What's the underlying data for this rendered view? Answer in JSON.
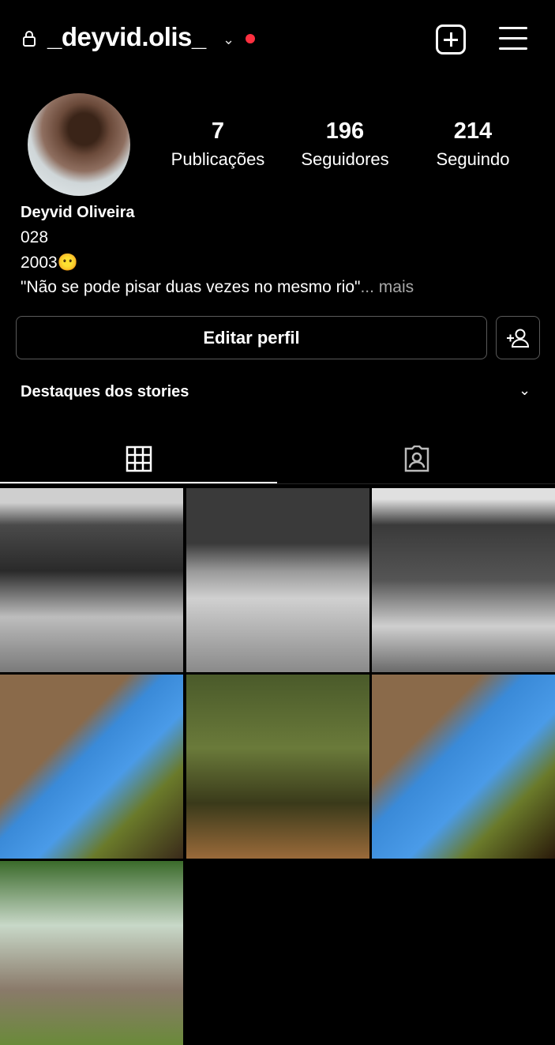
{
  "header": {
    "username": "_deyvid.olis_",
    "chevron": "⌄",
    "icons": [
      "lock-icon",
      "chevron-down-icon",
      "notification-dot",
      "new-post-icon",
      "menu-icon"
    ]
  },
  "stats": [
    {
      "value": "7",
      "label": "Publicações"
    },
    {
      "value": "196",
      "label": "Seguidores"
    },
    {
      "value": "214",
      "label": "Seguindo"
    }
  ],
  "bio": {
    "name": "Deyvid Oliveira",
    "line1": "028",
    "line2": "2003😶",
    "quote": "\"Não se pode pisar duas vezes no mesmo rio\"",
    "more": "... mais"
  },
  "buttons": {
    "edit_profile": "Editar perfil"
  },
  "highlights": {
    "label": "Destaques dos stories",
    "chevron": "⌄"
  },
  "tabs": [
    "grid-icon",
    "tagged-icon"
  ],
  "posts": [
    {
      "desc": "bw-trees-1"
    },
    {
      "desc": "bw-trees-2"
    },
    {
      "desc": "bw-trees-3"
    },
    {
      "desc": "rock-sky-1"
    },
    {
      "desc": "forest"
    },
    {
      "desc": "rock-sky-2"
    },
    {
      "desc": "park"
    }
  ],
  "colors": {
    "notification": "#ff3040",
    "background": "#000000",
    "border": "#5a5a5a"
  }
}
